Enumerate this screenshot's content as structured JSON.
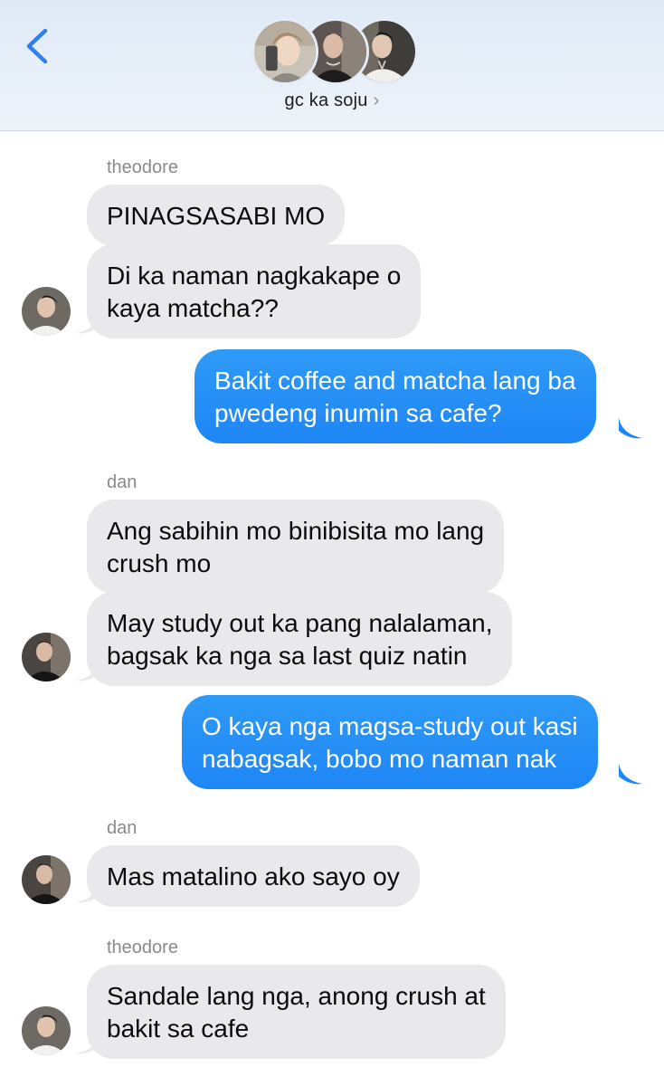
{
  "header": {
    "title": "gc ka soju",
    "title_chevron": "›",
    "back_icon": "chevron-left-icon"
  },
  "colors": {
    "accent": "#1e86f5",
    "incoming_bubble": "#e9e9eb",
    "header_bg": "#e4edf7"
  },
  "messages": [
    {
      "sender": "theodore",
      "direction": "in",
      "text": "PINAGSASABI MO"
    },
    {
      "direction": "in",
      "text": "Di ka naman nagkakape o\nkaya matcha??"
    },
    {
      "direction": "out",
      "text": "Bakit coffee and matcha lang ba\npwedeng inumin sa cafe?"
    },
    {
      "sender": "dan",
      "direction": "in",
      "text": "Ang sabihin mo binibisita mo lang\ncrush mo"
    },
    {
      "direction": "in",
      "text": "May study out ka pang nalalaman,\nbagsak ka nga sa last quiz natin"
    },
    {
      "direction": "out",
      "text": "O kaya nga magsa-study out kasi\nnabagsak, bobo mo naman nak"
    },
    {
      "sender": "dan",
      "direction": "in",
      "text": "Mas matalino ako sayo oy"
    },
    {
      "sender": "theodore",
      "direction": "in",
      "text": "Sandale lang nga, anong crush at\nbakit sa cafe"
    }
  ]
}
